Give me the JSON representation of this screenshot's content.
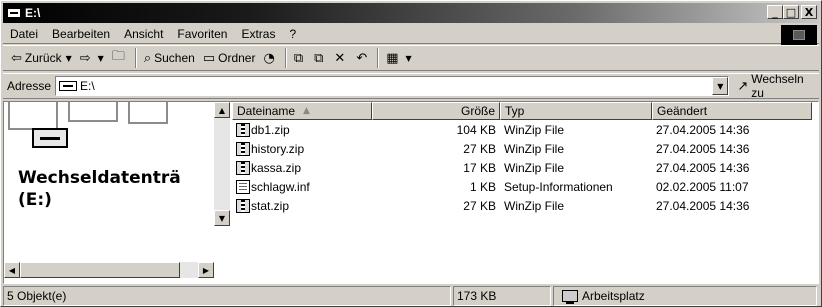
{
  "window": {
    "title": "E:\\",
    "buttons": {
      "minimize": "_",
      "maximize": "□",
      "close": "X"
    }
  },
  "menu": [
    {
      "label": "Datei"
    },
    {
      "label": "Bearbeiten"
    },
    {
      "label": "Ansicht"
    },
    {
      "label": "Favoriten"
    },
    {
      "label": "Extras"
    },
    {
      "label": "?"
    }
  ],
  "toolbar": {
    "back_label": "Zurück",
    "search_label": "Suchen",
    "folders_label": "Ordner",
    "icons": [
      "back-arrow-icon",
      "forward-arrow-icon",
      "up-folder-icon",
      "search-icon",
      "folders-icon",
      "history-icon",
      "move-to-icon",
      "copy-to-icon",
      "delete-icon",
      "undo-icon",
      "views-icon"
    ]
  },
  "address": {
    "label": "Adresse",
    "value": "E:\\",
    "go_label": "Wechseln zu"
  },
  "left_pane": {
    "title": "Wechseldatenträ",
    "subtitle": "(E:)"
  },
  "columns": {
    "name": "Dateiname",
    "size": "Größe",
    "type": "Typ",
    "modified": "Geändert"
  },
  "files": [
    {
      "name": "db1.zip",
      "size": "104 KB",
      "type": "WinZip File",
      "modified": "27.04.2005 14:36",
      "icon": "zip"
    },
    {
      "name": "history.zip",
      "size": "27 KB",
      "type": "WinZip File",
      "modified": "27.04.2005 14:36",
      "icon": "zip"
    },
    {
      "name": "kassa.zip",
      "size": "17 KB",
      "type": "WinZip File",
      "modified": "27.04.2005 14:36",
      "icon": "zip"
    },
    {
      "name": "schlagw.inf",
      "size": "1 KB",
      "type": "Setup-Informationen",
      "modified": "02.02.2005 11:07",
      "icon": "inf"
    },
    {
      "name": "stat.zip",
      "size": "27 KB",
      "type": "WinZip File",
      "modified": "27.04.2005 14:36",
      "icon": "zip"
    }
  ],
  "status": {
    "objects": "5 Objekt(e)",
    "size": "173 KB",
    "location": "Arbeitsplatz"
  }
}
